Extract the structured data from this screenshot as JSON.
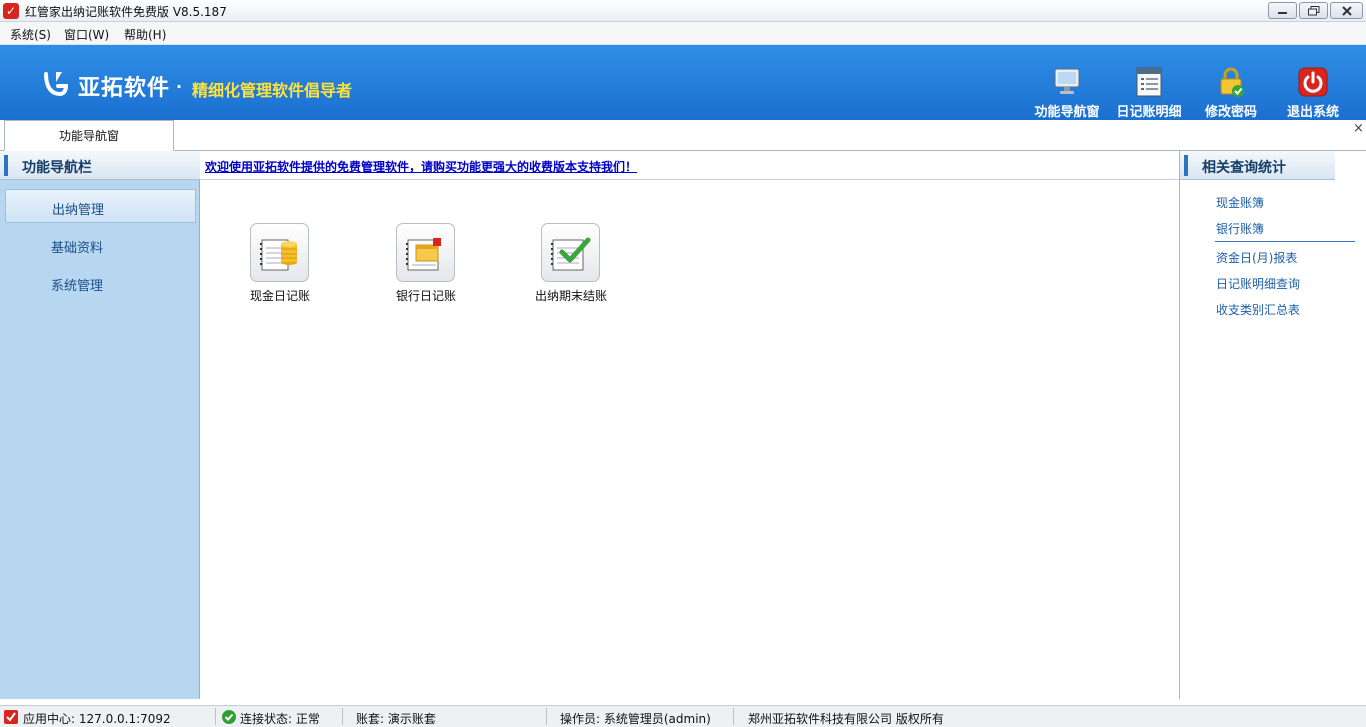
{
  "window": {
    "title": "红管家出纳记账软件免费版 V8.5.187"
  },
  "menu": {
    "items": [
      "系统(S)",
      "窗口(W)",
      "帮助(H)"
    ]
  },
  "banner": {
    "brand": "亚拓软件",
    "separator": "·",
    "slogan": "精细化管理软件倡导者",
    "slogan_color": "#ffe23a",
    "tools": [
      {
        "label": "功能导航窗",
        "icon": "monitor-icon"
      },
      {
        "label": "日记账明细",
        "icon": "list-document-icon"
      },
      {
        "label": "修改密码",
        "icon": "lock-icon"
      },
      {
        "label": "退出系统",
        "icon": "power-icon"
      }
    ]
  },
  "tabs": {
    "active": "功能导航窗",
    "close_glyph": "×"
  },
  "leftnav": {
    "title": "功能导航栏",
    "items": [
      "出纳管理",
      "基础资料",
      "系统管理"
    ]
  },
  "main": {
    "notice": "欢迎使用亚拓软件提供的免费管理软件，请购买功能更强大的收费版本支持我们！",
    "functions": [
      {
        "label": "现金日记账",
        "icon": "cash-journal-icon"
      },
      {
        "label": "银行日记账",
        "icon": "bank-journal-icon"
      },
      {
        "label": "出纳期末结账",
        "icon": "period-close-icon"
      }
    ]
  },
  "rightpanel": {
    "title": "相关查询统计",
    "links": [
      "现金账簿",
      "银行账簿",
      "资金日(月)报表",
      "日记账明细查询",
      "收支类别汇总表"
    ]
  },
  "status": {
    "center": "应用中心: 127.0.0.1:7092",
    "connection": "连接状态: 正常",
    "account_set": "账套: 演示账套",
    "operator": "操作员: 系统管理员(admin)",
    "copyright": "郑州亚拓软件科技有限公司 版权所有"
  },
  "colors": {
    "banner": "#2f8fe6",
    "nav_bg": "#b7d6ef",
    "link": "#1d5fa8",
    "notice": "#0000c8",
    "accent_red": "#d8251d"
  }
}
